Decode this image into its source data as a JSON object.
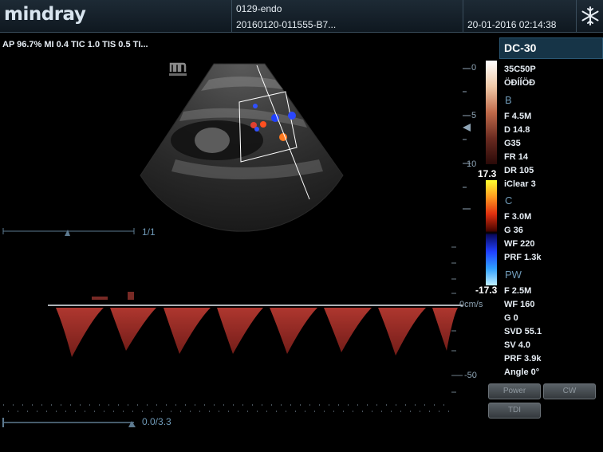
{
  "header": {
    "brand": "mindray",
    "patient_id": "0129-endo",
    "exam_id": "20160120-011555-B7...",
    "datetime": "20-01-2016 02:14:38",
    "freeze_icon": "snowflake-icon"
  },
  "top_params": "AP 96.7%  MI 0.4 TIC 1.0 TIS 0.5 TI...",
  "probe_panel": {
    "title": "DC-30",
    "probe": "35C50P",
    "preset": "ÖĐÍÍÖĐ",
    "b_label": "B",
    "b_params": [
      "F 4.5M",
      "D 14.8",
      "G35",
      "FR 14",
      "DR 105",
      "iClear 3"
    ],
    "c_label": "C",
    "c_params": [
      "F 3.0M",
      "G 36",
      "WF 220",
      "PRF 1.3k"
    ],
    "pw_label": "PW",
    "pw_params": [
      "F 2.5M",
      "WF 160",
      "G 0",
      "SVD 55.1",
      "SV 4.0",
      "PRF 3.9k",
      "Angle 0°"
    ]
  },
  "color_scale": {
    "max": "17.3",
    "min": "-17.3"
  },
  "depth_scale": {
    "tick0": "0",
    "tick5": "5",
    "tick10": "10"
  },
  "doppler_scale": {
    "zero": "0cm/s",
    "neg": "-50"
  },
  "image_counter": "1/1",
  "time_counter": "0.0/3.3",
  "buttons": {
    "power": "Power",
    "cw": "CW",
    "tdi": "TDI"
  },
  "colors": {
    "header_bg": "#15212b",
    "accent": "#2a5672",
    "doppler": "#c8463f"
  }
}
